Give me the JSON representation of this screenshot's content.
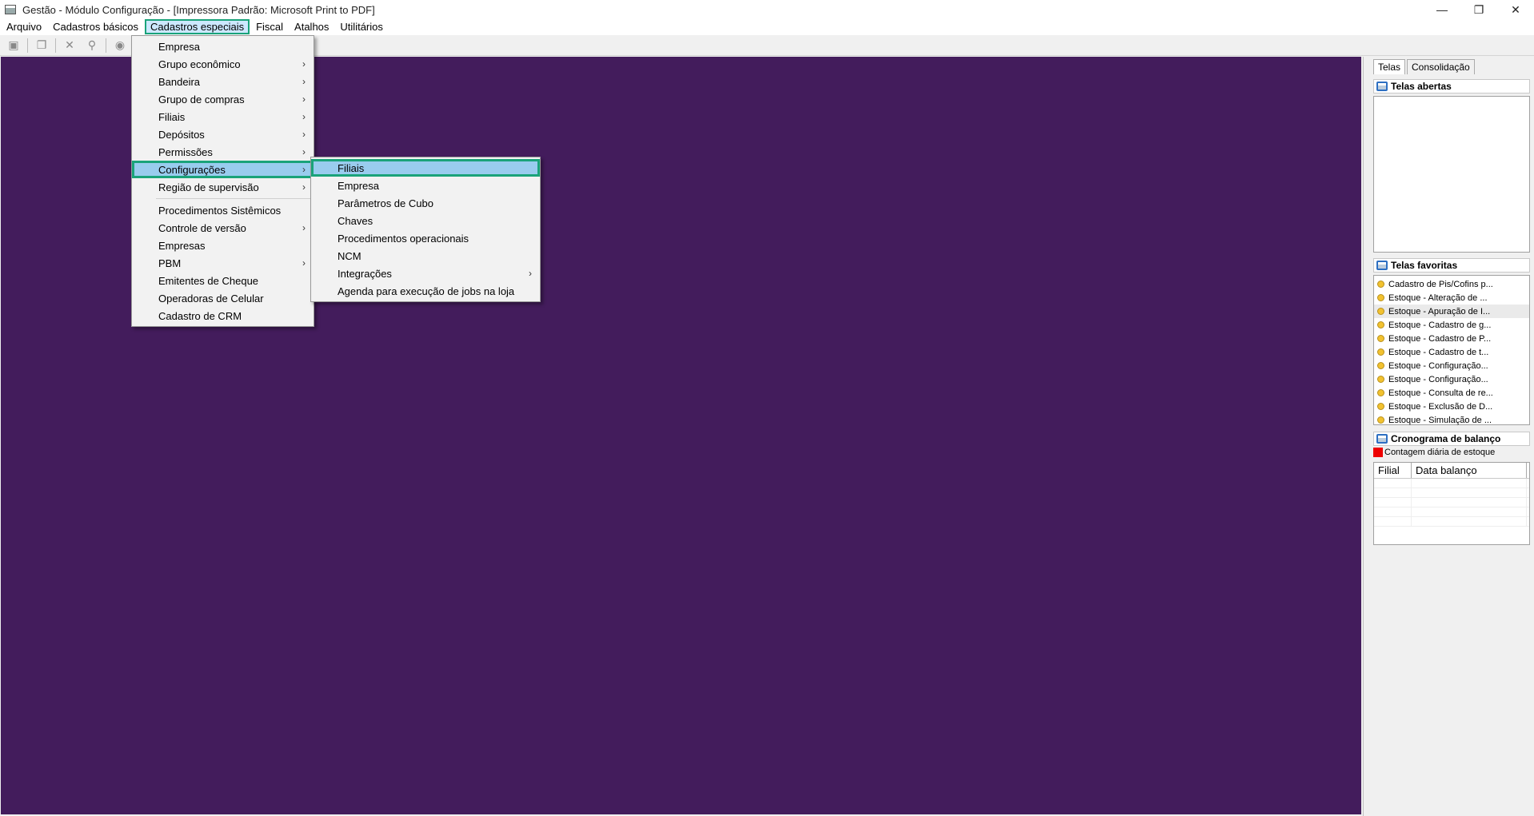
{
  "window": {
    "title": "Gestão  - Módulo Configuração - [Impressora Padrão: Microsoft Print to PDF]",
    "controls": [
      "—",
      "❐",
      "✕"
    ]
  },
  "menubar": {
    "items": [
      "Arquivo",
      "Cadastros básicos",
      "Cadastros especiais",
      "Fiscal",
      "Atalhos",
      "Utilitários"
    ],
    "active": "Cadastros especiais"
  },
  "toolbar": {
    "icons": [
      "save-icon",
      "copy-icon",
      "delete-icon",
      "search-icon",
      "record-icon"
    ]
  },
  "menu_cadastros_especiais": {
    "items": [
      {
        "label": "Empresa",
        "submenu": false
      },
      {
        "label": "Grupo econômico",
        "submenu": true
      },
      {
        "label": "Bandeira",
        "submenu": true
      },
      {
        "label": "Grupo de compras",
        "submenu": true
      },
      {
        "label": "Filiais",
        "submenu": true
      },
      {
        "label": "Depósitos",
        "submenu": true
      },
      {
        "label": "Permissões",
        "submenu": true
      },
      {
        "label": "Configurações",
        "submenu": true,
        "selected": true
      },
      {
        "label": "Região de supervisão",
        "submenu": true
      },
      {
        "label": "Procedimentos Sistêmicos",
        "submenu": false,
        "sep_before": true
      },
      {
        "label": "Controle de versão",
        "submenu": true
      },
      {
        "label": "Empresas",
        "submenu": false
      },
      {
        "label": "PBM",
        "submenu": true
      },
      {
        "label": "Emitentes de Cheque",
        "submenu": false
      },
      {
        "label": "Operadoras de Celular",
        "submenu": false
      },
      {
        "label": "Cadastro de CRM",
        "submenu": false
      }
    ]
  },
  "submenu_configuracoes": {
    "items": [
      {
        "label": "Filiais",
        "submenu": false,
        "selected": true
      },
      {
        "label": "Empresa",
        "submenu": false
      },
      {
        "label": "Parâmetros de Cubo",
        "submenu": false
      },
      {
        "label": "Chaves",
        "submenu": false
      },
      {
        "label": "Procedimentos operacionais",
        "submenu": false
      },
      {
        "label": "NCM",
        "submenu": false
      },
      {
        "label": "Integrações",
        "submenu": true
      },
      {
        "label": "Agenda para execução de jobs na loja",
        "submenu": false
      }
    ]
  },
  "right_panel": {
    "tabs": [
      "Telas",
      "Consolidação"
    ],
    "telas_abertas": "Telas abertas",
    "telas_favoritas": "Telas favoritas",
    "favoritas": [
      "Cadastro de Pis/Cofins p...",
      "Estoque - Alteração de ...",
      "Estoque - Apuração de I...",
      "Estoque - Cadastro de g...",
      "Estoque - Cadastro de P...",
      "Estoque - Cadastro de t...",
      "Estoque - Configuração...",
      "Estoque - Configuração...",
      "Estoque - Consulta de re...",
      "Estoque - Exclusão de D...",
      "Estoque - Simulação de ..."
    ],
    "cronograma": "Cronograma de balanço",
    "legend": "Contagem diária de estoque",
    "grid_columns": [
      "Filial",
      "Data balanço"
    ]
  },
  "colors": {
    "workspace": "#431c5c",
    "highlight_border": "#1aa37a",
    "selection": "#99ccee"
  }
}
